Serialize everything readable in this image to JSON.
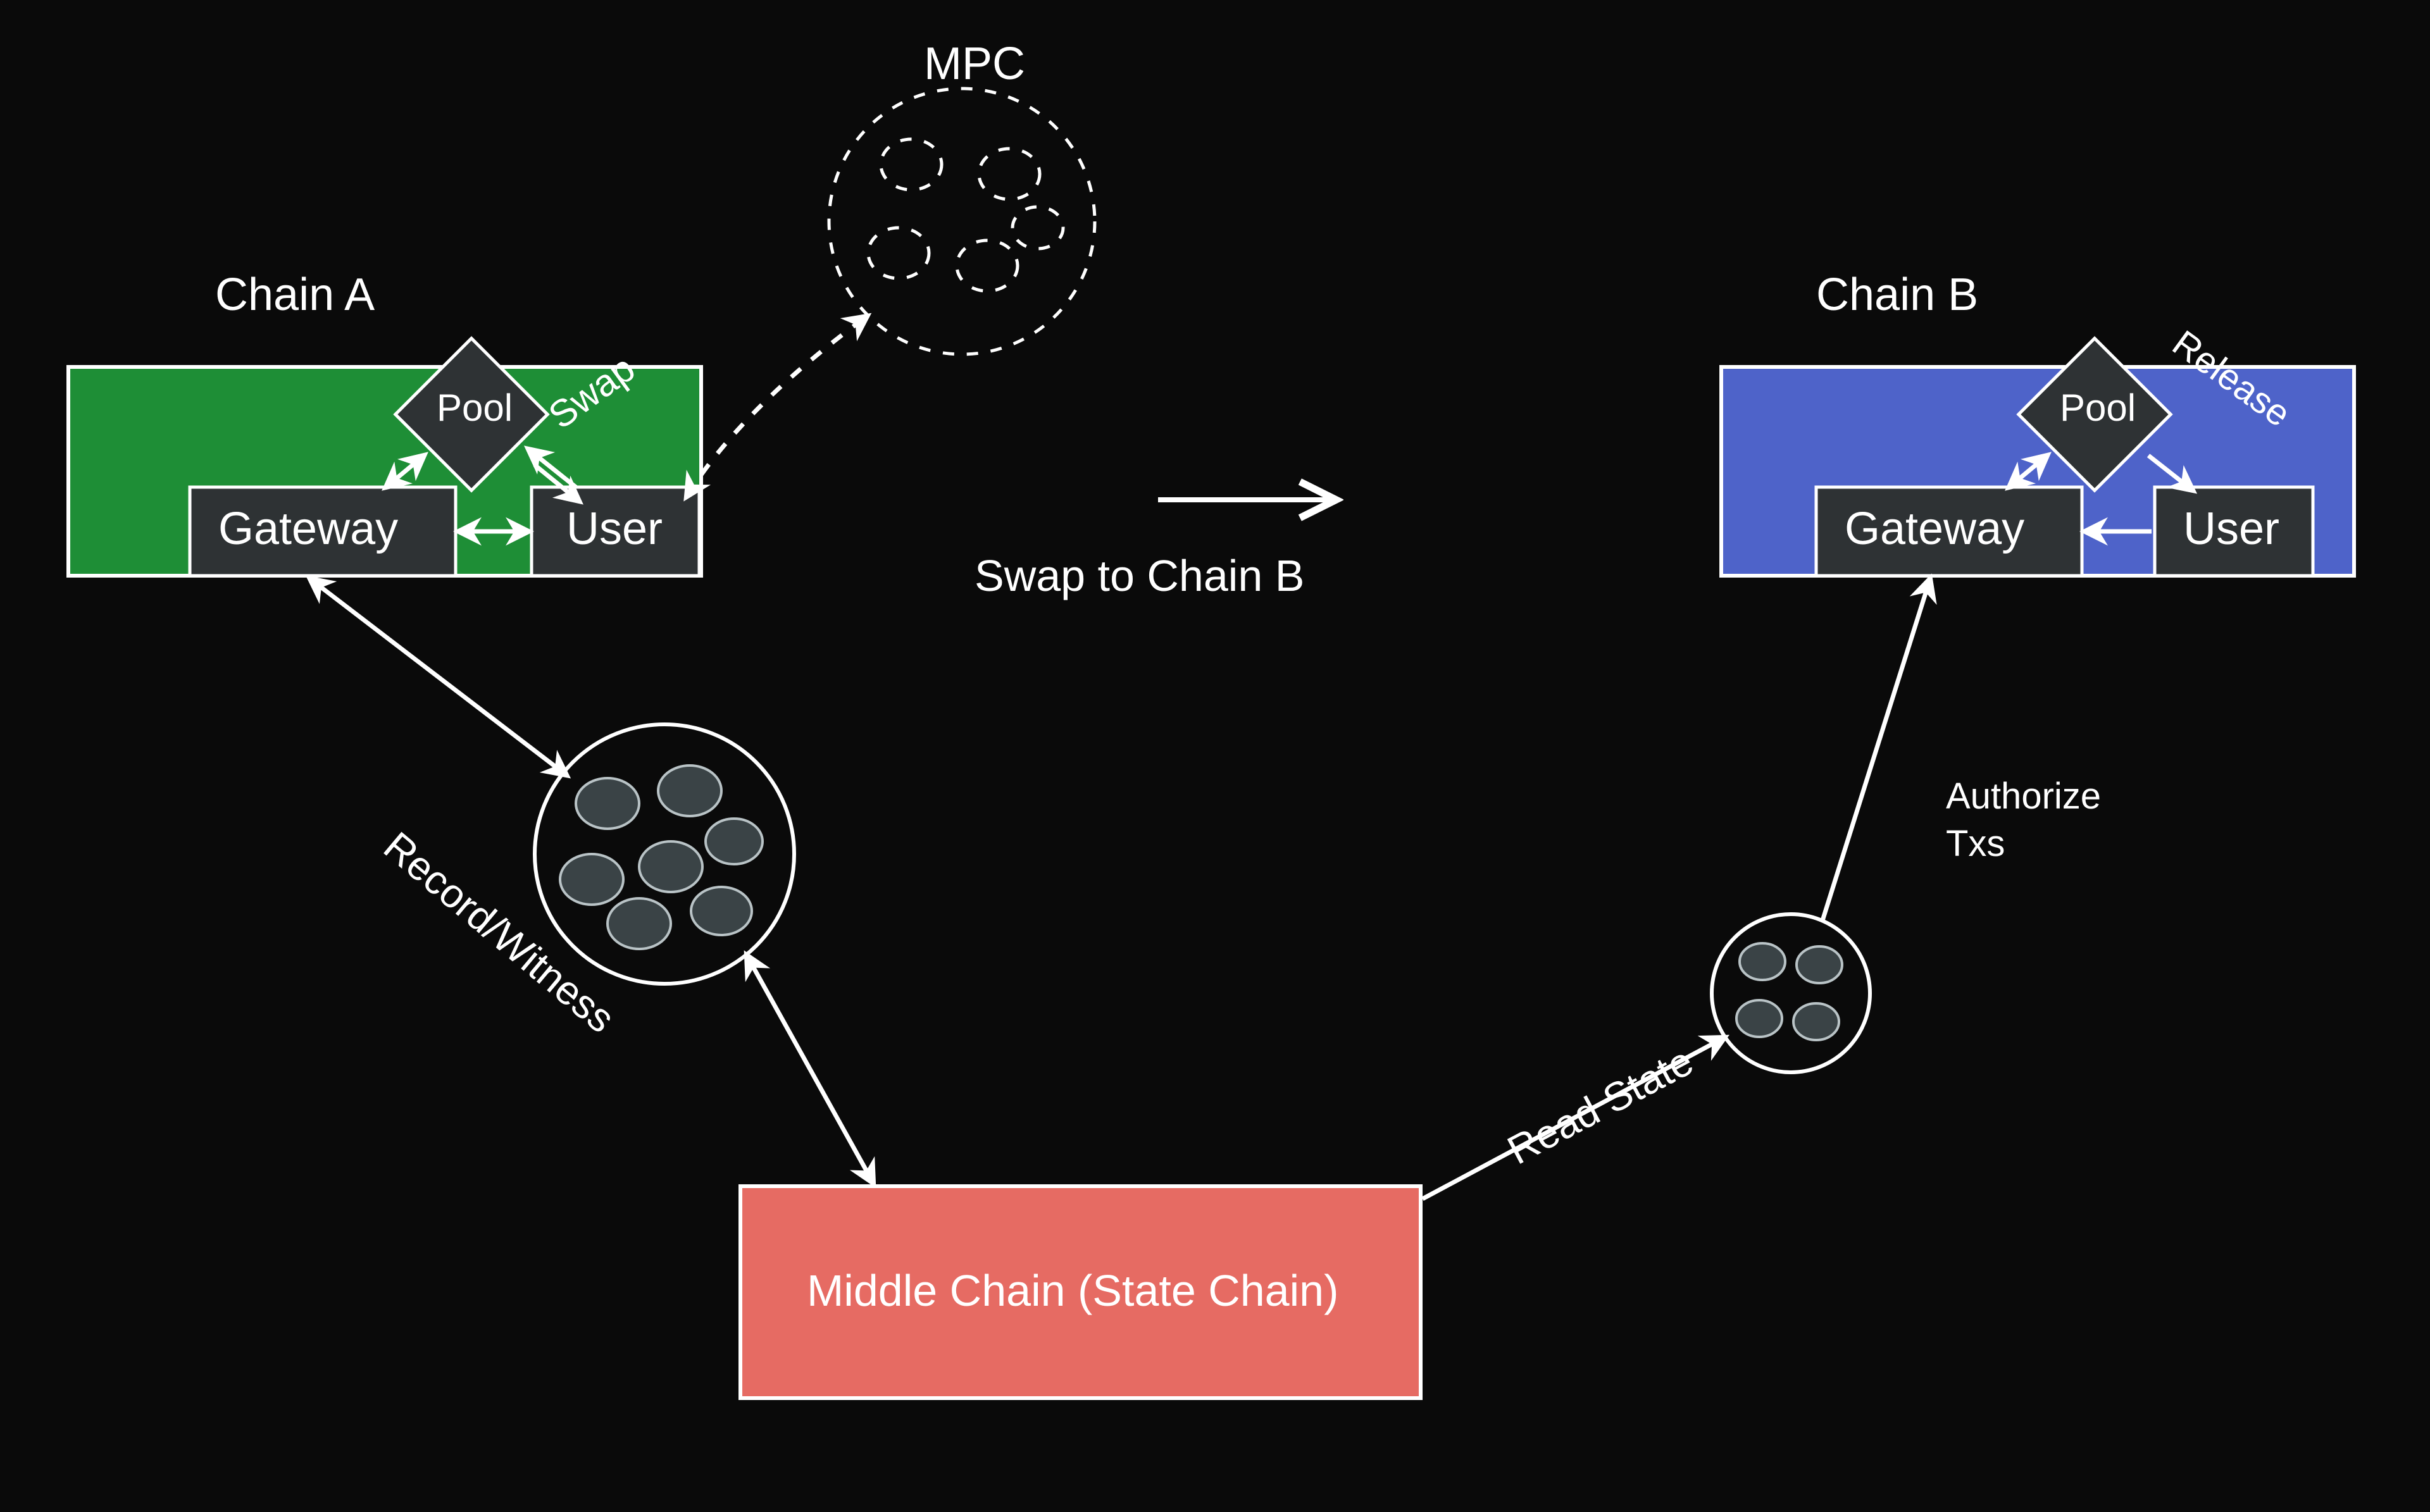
{
  "colors": {
    "bg": "#0a0a0a",
    "ink": "#ffffff",
    "chain_a": "#1e8e36",
    "chain_b": "#4e63c9",
    "middle_chain": "#e66b63",
    "box_dark": "#2e3234",
    "node_fill": "#3a4346"
  },
  "labels": {
    "chain_a_title": "Chain A",
    "chain_b_title": "Chain B",
    "mpc": "MPC",
    "pool_a": "Pool",
    "pool_b": "Pool",
    "swap": "Swap",
    "release": "Release",
    "gateway_a": "Gateway",
    "gateway_b": "Gateway",
    "user_a": "User",
    "user_b": "User",
    "swap_to_chain_b": "Swap to Chain B",
    "record_witness": "Record/Witness",
    "authorize_txs_l1": "Authorize",
    "authorize_txs_l2": "Txs",
    "read_state": "Read State",
    "middle_chain": "Middle Chain (State Chain)"
  },
  "nodes": {
    "chain_a": {
      "type": "chain",
      "color": "green"
    },
    "chain_b": {
      "type": "chain",
      "color": "blue"
    },
    "middle_chain": {
      "type": "chain",
      "color": "red"
    },
    "mpc": {
      "type": "validator-set",
      "style": "dashed"
    },
    "witness_cluster": {
      "type": "validator-set",
      "style": "solid"
    },
    "signer_cluster": {
      "type": "validator-set",
      "style": "solid"
    },
    "gateway_a": {
      "type": "contract"
    },
    "gateway_b": {
      "type": "contract"
    },
    "user_a": {
      "type": "actor"
    },
    "user_b": {
      "type": "actor"
    },
    "pool_a": {
      "type": "pool"
    },
    "pool_b": {
      "type": "pool"
    }
  },
  "edges": [
    {
      "from": "user_a",
      "to": "mpc",
      "style": "dashed",
      "label": null,
      "direction": "both"
    },
    {
      "from": "user_a",
      "to": "pool_a",
      "label": "Swap",
      "direction": "both"
    },
    {
      "from": "user_a",
      "to": "gateway_a",
      "label": null,
      "direction": "both"
    },
    {
      "from": "gateway_a",
      "to": "pool_a",
      "label": null,
      "direction": "both"
    },
    {
      "from": "gateway_a",
      "to": "middle_chain",
      "via": "witness_cluster",
      "label": "Record/Witness",
      "direction": "both"
    },
    {
      "from": "middle_chain",
      "to": "gateway_b",
      "via": "signer_cluster",
      "label_segment1": "Read State",
      "label_segment2": "Authorize Txs",
      "direction": "forward"
    },
    {
      "from": "user_b",
      "to": "gateway_b",
      "label": null,
      "direction": "forward"
    },
    {
      "from": "gateway_b",
      "to": "pool_b",
      "label": null,
      "direction": "both"
    },
    {
      "from": "pool_b",
      "to": "user_b",
      "label": "Release",
      "direction": "forward"
    },
    {
      "from": "chain_a",
      "to": "chain_b",
      "label": "Swap to Chain B",
      "direction": "forward",
      "style": "conceptual"
    }
  ]
}
